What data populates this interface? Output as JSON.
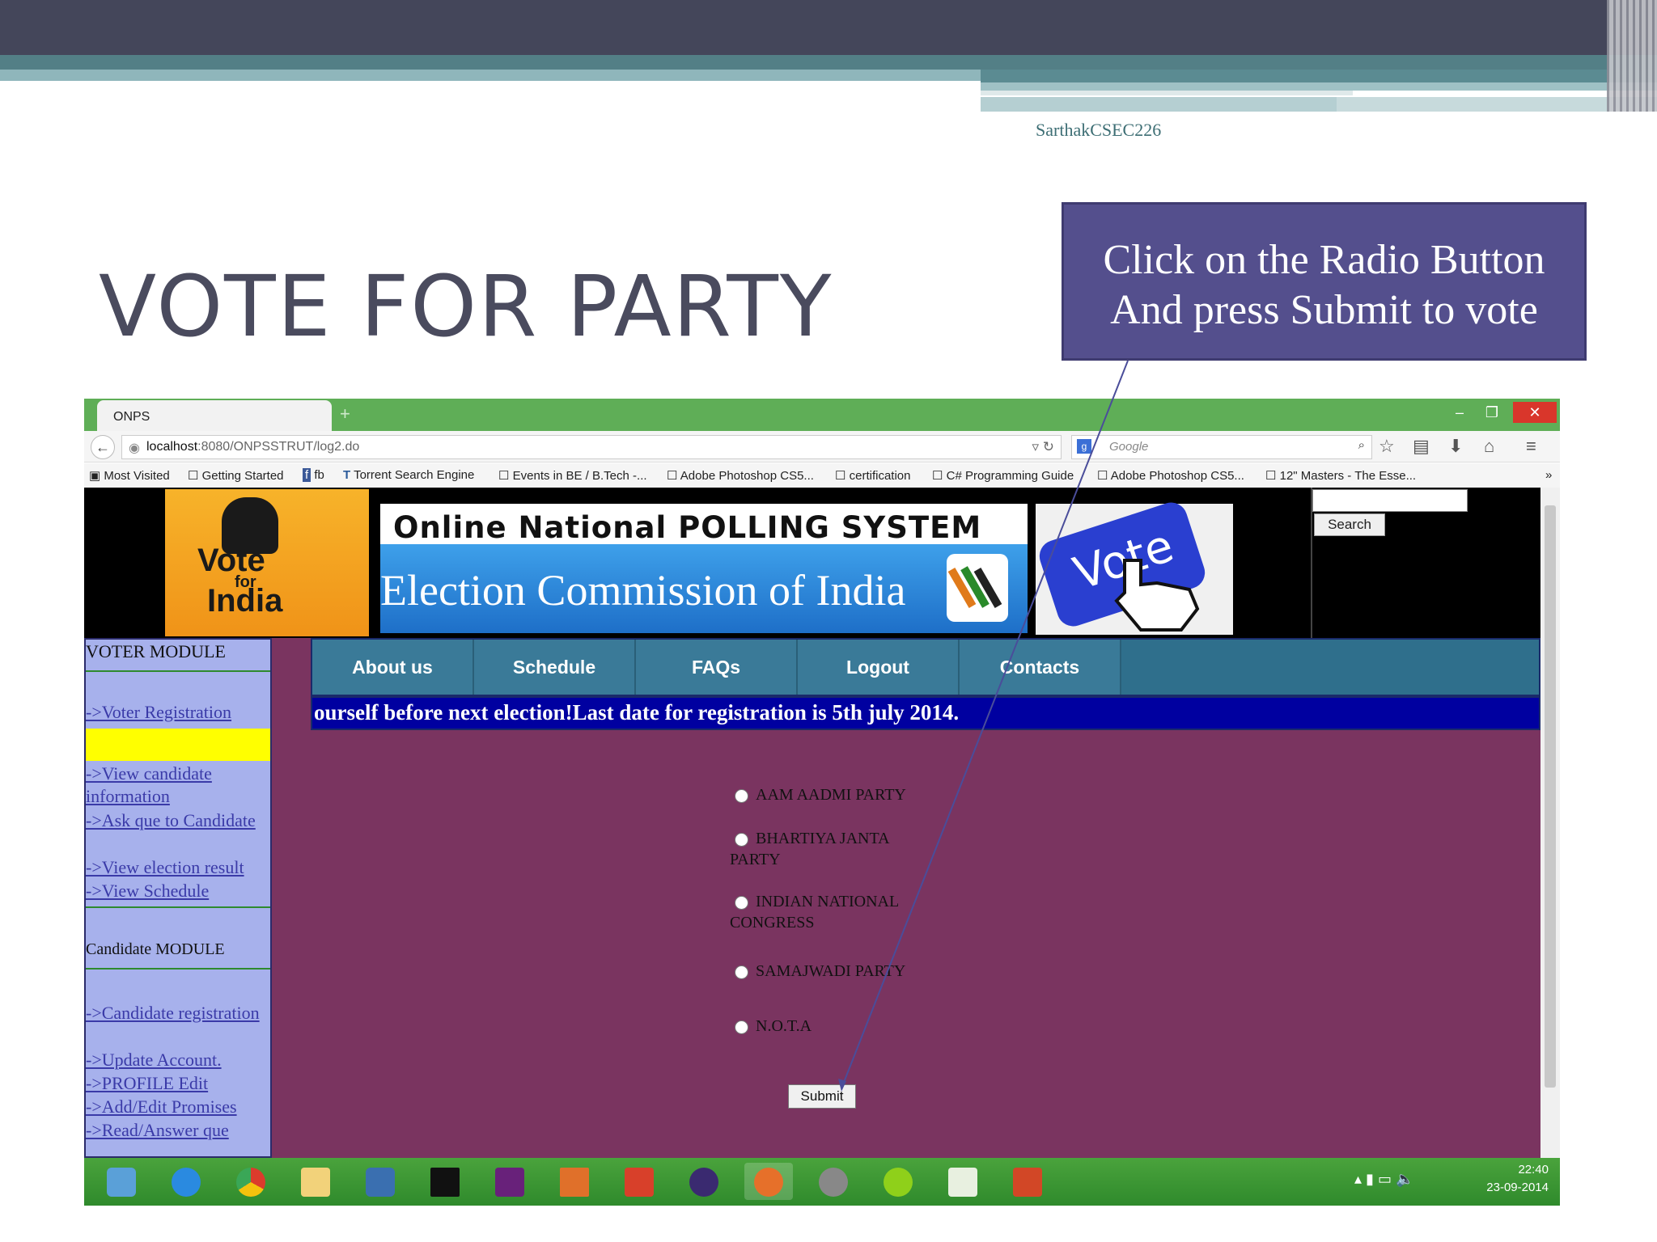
{
  "slide": {
    "author": "SarthakCSEC226",
    "title": "VOTE FOR PARTY",
    "callout_line1": "Click on the Radio Button",
    "callout_line2": "And press Submit to vote"
  },
  "browser": {
    "tab_label": "ONPS",
    "new_tab": "+",
    "url_host": "localhost",
    "url_rest": ":8080/ONPSSTRUT/log2.do",
    "search_placeholder": "Google",
    "bookmarks": [
      "Most Visited",
      "Getting Started",
      "fb",
      "Torrent Search Engine",
      "Events in BE / B.Tech -...",
      "Adobe Photoshop CS5...",
      "certification",
      "C# Programming Guide",
      "Adobe Photoshop CS5...",
      "12\" Masters - The Esse..."
    ],
    "bookmarks_more": "»"
  },
  "site": {
    "logo_vote": "Vote",
    "logo_for": "for",
    "logo_india": "India",
    "banner_top": "Online National POLLING SYSTEM",
    "banner_bottom": "Election Commission of India",
    "vote_key": "Vote",
    "search_button": "Search",
    "voter_module": "VOTER MODULE",
    "voter_links": [
      "->Voter Registration",
      "->View candidate information",
      "->Ask que to Candidate",
      "->View election result",
      "->View Schedule"
    ],
    "candidate_module": "Candidate MODULE",
    "candidate_links": [
      "->Candidate registration",
      "->Update Account.",
      "->PROFILE Edit",
      "->Add/Edit Promises",
      "->Read/Answer que"
    ],
    "nav_tabs": [
      "About us",
      "Schedule",
      "FAQs",
      "Logout",
      "Contacts"
    ],
    "marquee": "ourself before next election!Last date for registration is 5th july 2014.",
    "parties": [
      "AAM AADMI PARTY",
      "BHARTIYA JANTA PARTY",
      "INDIAN NATIONAL CONGRESS",
      "SAMAJWADI PARTY",
      "N.O.T.A"
    ],
    "submit_label": "Submit"
  },
  "taskbar": {
    "time": "22:40",
    "date": "23-09-2014"
  },
  "colors": {
    "slide_band": "#44465a",
    "callout_bg": "#544f8d",
    "page_bg": "#7a3460",
    "leftnav_bg": "#a7b1ec",
    "marquee_bg": "#0000a0",
    "taskbar_bg": "#3a9a34"
  }
}
